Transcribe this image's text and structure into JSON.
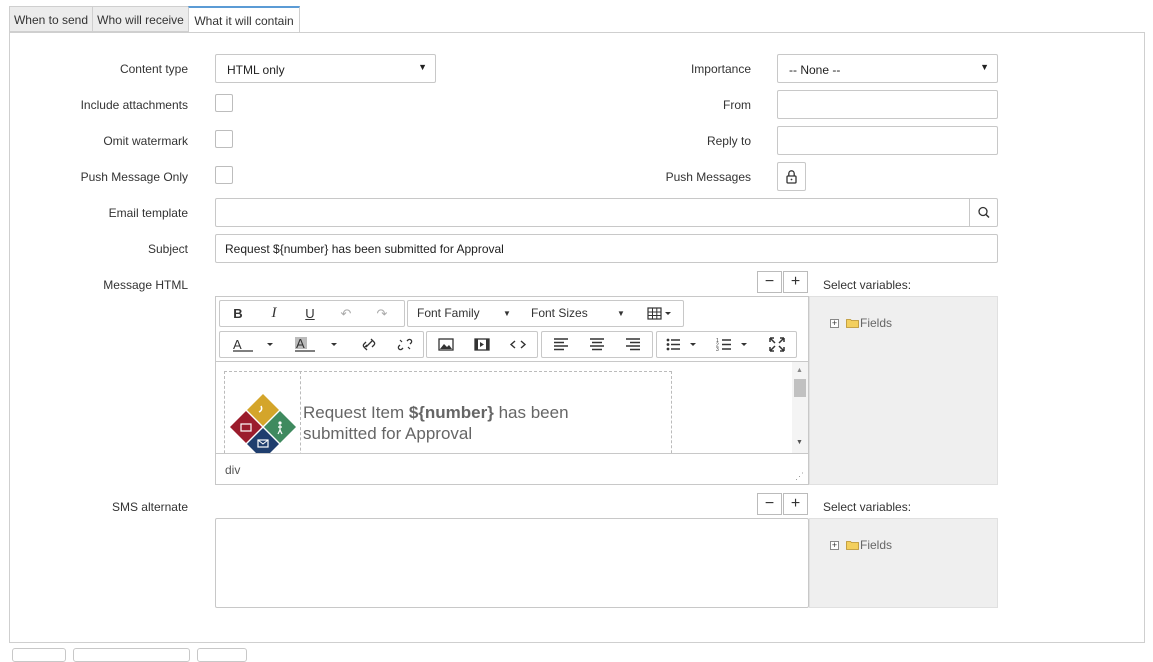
{
  "tabs": [
    {
      "label": "When to send"
    },
    {
      "label": "Who will receive"
    },
    {
      "label": "What it will contain"
    }
  ],
  "form": {
    "content_type": {
      "label": "Content type",
      "value": "HTML only"
    },
    "include_attachments": {
      "label": "Include attachments"
    },
    "omit_watermark": {
      "label": "Omit watermark"
    },
    "push_message_only": {
      "label": "Push Message Only"
    },
    "email_template": {
      "label": "Email template",
      "value": ""
    },
    "subject": {
      "label": "Subject",
      "value": "Request ${number} has been submitted for Approval"
    },
    "message_html": {
      "label": "Message HTML"
    },
    "sms_alternate": {
      "label": "SMS alternate",
      "value": ""
    },
    "importance": {
      "label": "Importance",
      "value": "-- None --"
    },
    "from": {
      "label": "From",
      "value": ""
    },
    "reply_to": {
      "label": "Reply to",
      "value": ""
    },
    "push_messages": {
      "label": "Push Messages"
    }
  },
  "editor": {
    "font_family": "Font Family",
    "font_sizes": "Font Sizes",
    "content_prefix": "Request Item ",
    "content_var": "${number}",
    "content_suffix_1": " has been",
    "content_line2": "submitted for Approval",
    "status_path": "div"
  },
  "variables": {
    "label": "Select variables:",
    "tree_root": "Fields"
  },
  "colors": {
    "tab_active_border": "#5b9bd5",
    "logo_gold": "#d4a52a",
    "logo_green": "#3f8a5f",
    "logo_red": "#9b1c2c",
    "logo_navy": "#1f3e6e"
  }
}
